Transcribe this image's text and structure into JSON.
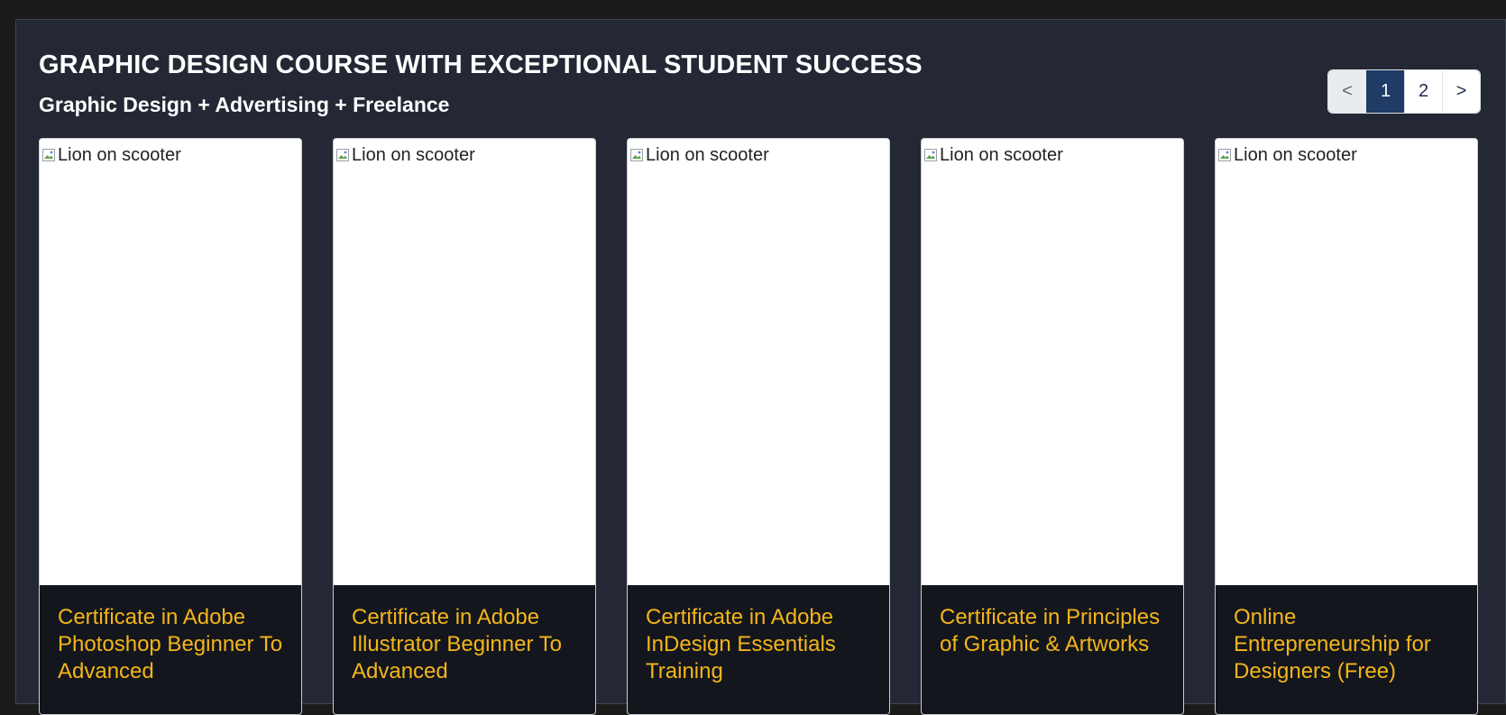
{
  "section": {
    "title": "GRAPHIC DESIGN COURSE WITH EXCEPTIONAL STUDENT SUCCESS",
    "subtitle": "Graphic Design + Advertising + Freelance"
  },
  "pagination": {
    "prev_label": "<",
    "pages": [
      "1",
      "2"
    ],
    "current_page": "1",
    "next_label": ">"
  },
  "cards": [
    {
      "image_alt": "Lion on scooter",
      "title": "Certificate in Adobe Photoshop Beginner To Advanced"
    },
    {
      "image_alt": "Lion on scooter",
      "title": "Certificate in Adobe Illustrator Beginner To Advanced"
    },
    {
      "image_alt": "Lion on scooter",
      "title": "Certificate in Adobe InDesign Essentials Training"
    },
    {
      "image_alt": "Lion on scooter",
      "title": "Certificate in Principles of Graphic & Artworks"
    },
    {
      "image_alt": "Lion on scooter",
      "title": "Online Entrepreneurship for Designers (Free)"
    }
  ],
  "icons": {
    "broken_image": "broken-image-icon"
  },
  "colors": {
    "panel_bg": "#232834",
    "card_title": "#f5b51b",
    "active_page": "#1f3b66"
  }
}
